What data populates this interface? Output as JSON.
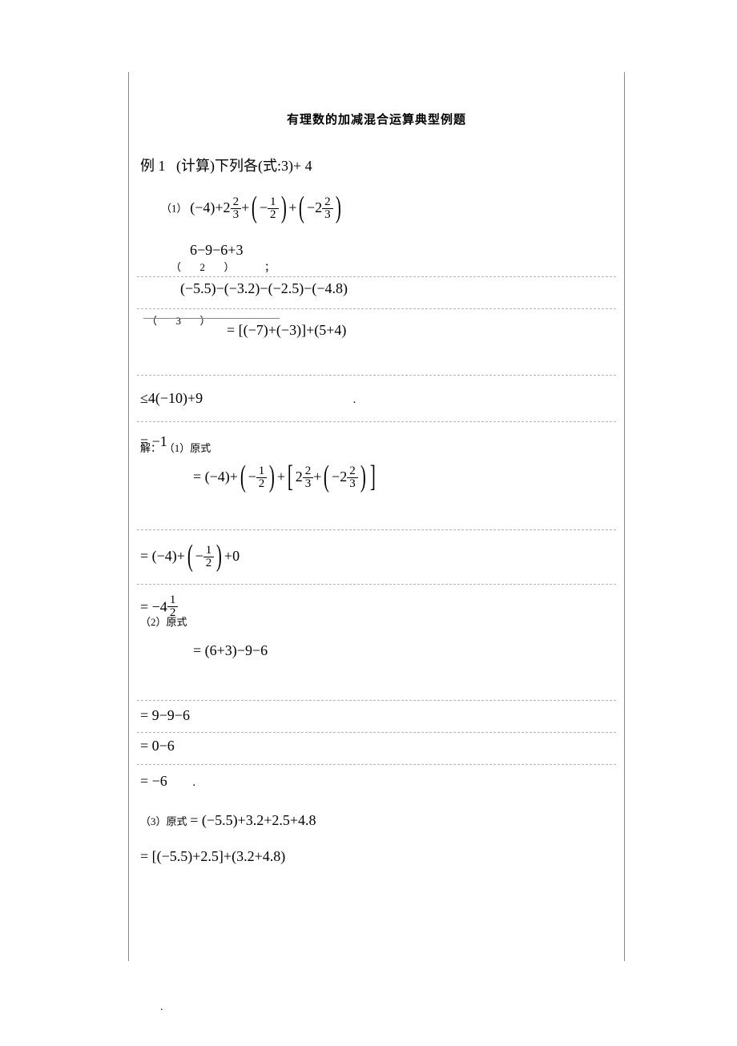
{
  "title": "有理数的加减混合运算典型例题",
  "ex1_label": "例 1",
  "ex1_text_overlay": "(计算)下列各(式:3)+ 4",
  "item1_label": "（1）",
  "expr_num_1": "6−9−6+3",
  "paren2_num": "2",
  "semicolon": "；",
  "expr_55": "(−5.5)−(−3.2)−(−2.5)−(−4.8)",
  "paren3_num": "3",
  "eq_line1": "= [(−7)+(−3)]+(5+4)",
  "eq4_overlay": "≤4(−10)+9",
  "dot": ".",
  "sol_label": "解：",
  "sol1_overlay": "= −1",
  "sol1_text": "（1）原式",
  "step1c": "= (−4)+",
  "zero": "+0",
  "final1_a": "= −4",
  "final1_b": "（2）原式",
  "step2a": "= (6+3)−9−6",
  "step2b": "= 9−9−6",
  "step2c": "= 0−6",
  "step2d": "= −6",
  "sol3_label": "（3）原式",
  "step3a": "= (−5.5)+3.2+2.5+4.8",
  "step3b": "= [(−5.5)+2.5]+(3.2+4.8)",
  "footer_dot": "."
}
